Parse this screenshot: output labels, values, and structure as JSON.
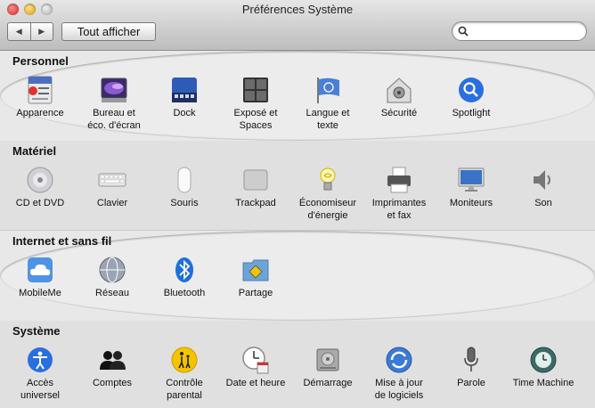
{
  "window": {
    "title": "Préférences Système"
  },
  "toolbar": {
    "back_label": "◀",
    "forward_label": "▶",
    "show_all_label": "Tout afficher",
    "search_value": "",
    "search_placeholder": ""
  },
  "sections": [
    {
      "title": "Personnel",
      "items": [
        {
          "label": "Apparence",
          "icon": "appearance-icon"
        },
        {
          "label": "Bureau et\néco. d'écran",
          "icon": "desktop-screensaver-icon"
        },
        {
          "label": "Dock",
          "icon": "dock-icon"
        },
        {
          "label": "Exposé et\nSpaces",
          "icon": "expose-spaces-icon"
        },
        {
          "label": "Langue et\ntexte",
          "icon": "language-text-icon"
        },
        {
          "label": "Sécurité",
          "icon": "security-icon"
        },
        {
          "label": "Spotlight",
          "icon": "spotlight-icon"
        }
      ]
    },
    {
      "title": "Matériel",
      "items": [
        {
          "label": "CD et DVD",
          "icon": "cd-dvd-icon"
        },
        {
          "label": "Clavier",
          "icon": "keyboard-icon"
        },
        {
          "label": "Souris",
          "icon": "mouse-icon"
        },
        {
          "label": "Trackpad",
          "icon": "trackpad-icon"
        },
        {
          "label": "Économiseur\nd'énergie",
          "icon": "energy-saver-icon"
        },
        {
          "label": "Imprimantes\net fax",
          "icon": "printer-icon"
        },
        {
          "label": "Moniteurs",
          "icon": "display-icon"
        },
        {
          "label": "Son",
          "icon": "sound-icon"
        }
      ]
    },
    {
      "title": "Internet et sans fil",
      "items": [
        {
          "label": "MobileMe",
          "icon": "mobileme-icon"
        },
        {
          "label": "Réseau",
          "icon": "network-icon"
        },
        {
          "label": "Bluetooth",
          "icon": "bluetooth-icon"
        },
        {
          "label": "Partage",
          "icon": "sharing-icon"
        }
      ]
    },
    {
      "title": "Système",
      "items": [
        {
          "label": "Accès\nuniversel",
          "icon": "universal-access-icon"
        },
        {
          "label": "Comptes",
          "icon": "accounts-icon"
        },
        {
          "label": "Contrôle\nparental",
          "icon": "parental-controls-icon"
        },
        {
          "label": "Date et heure",
          "icon": "date-time-icon"
        },
        {
          "label": "Démarrage",
          "icon": "startup-disk-icon"
        },
        {
          "label": "Mise à jour\nde logiciels",
          "icon": "software-update-icon"
        },
        {
          "label": "Parole",
          "icon": "speech-icon"
        },
        {
          "label": "Time Machine",
          "icon": "time-machine-icon"
        }
      ]
    }
  ]
}
